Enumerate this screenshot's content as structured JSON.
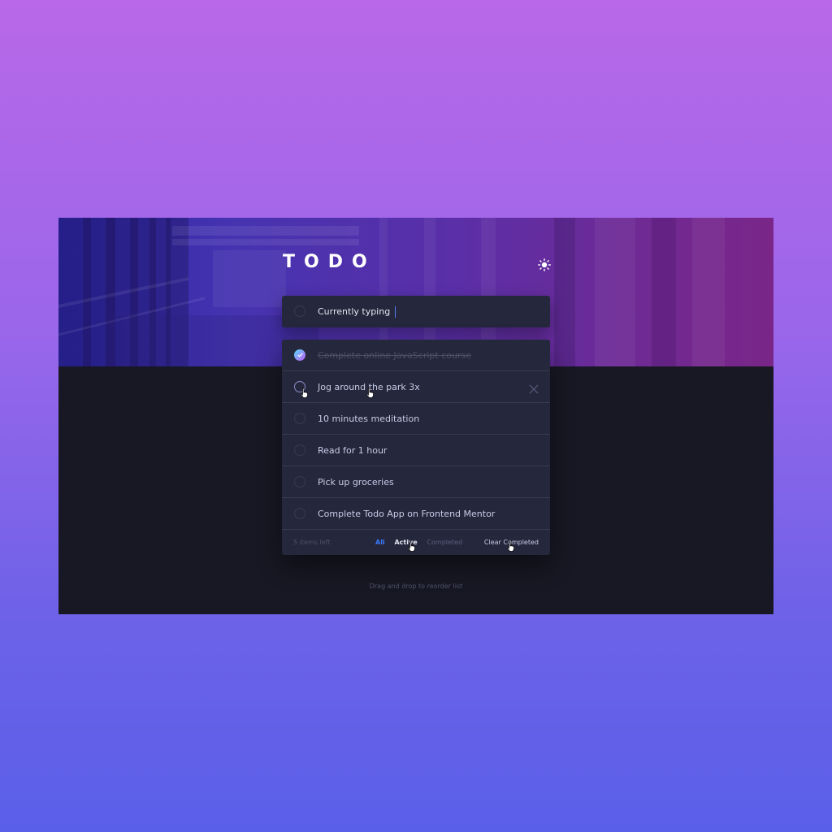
{
  "app": {
    "title": "TODO",
    "theme_icon": "sun-icon"
  },
  "new_todo": {
    "value": "Currently typing"
  },
  "todos": [
    {
      "text": "Complete online JavaScript course",
      "completed": true
    },
    {
      "text": "Jog around the park 3x",
      "completed": false
    },
    {
      "text": "10 minutes meditation",
      "completed": false
    },
    {
      "text": "Read for 1 hour",
      "completed": false
    },
    {
      "text": "Pick up groceries",
      "completed": false
    },
    {
      "text": "Complete Todo App on Frontend Mentor",
      "completed": false
    }
  ],
  "footer": {
    "items_left": "5 items left",
    "filters": [
      "All",
      "Active",
      "Completed"
    ],
    "active_filter": "All",
    "clear_label": "Clear Completed"
  },
  "hint": "Drag and drop to reorder list",
  "colors": {
    "accent": "#3a7bfd",
    "check_gradient_start": "#57ddff",
    "check_gradient_end": "#c058f3",
    "card": "#25273c",
    "background": "#181824"
  }
}
